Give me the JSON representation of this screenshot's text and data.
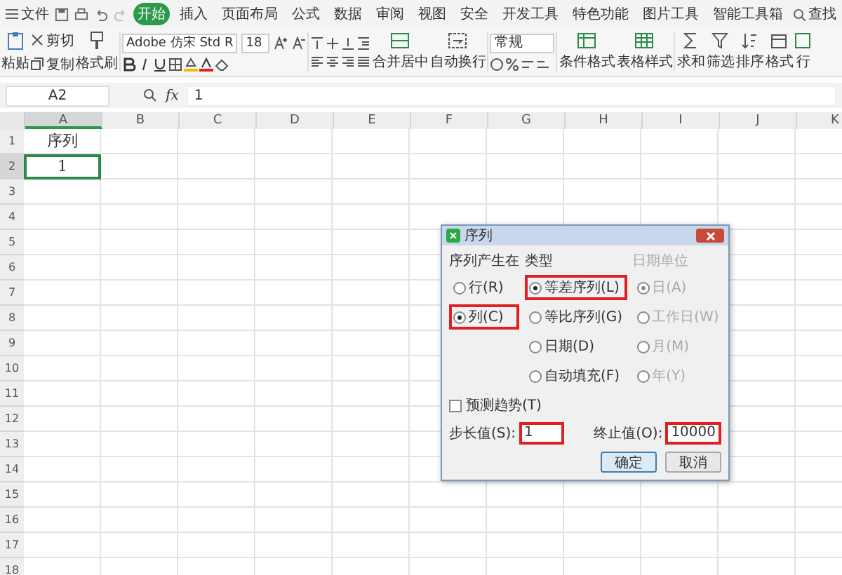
{
  "toolbar": {
    "menu_button": "文件",
    "tabs": [
      {
        "label": "开始",
        "selected": true
      },
      {
        "label": "插入",
        "selected": false
      },
      {
        "label": "页面布局",
        "selected": false
      },
      {
        "label": "公式",
        "selected": false
      },
      {
        "label": "数据",
        "selected": false
      },
      {
        "label": "审阅",
        "selected": false
      },
      {
        "label": "视图",
        "selected": false
      },
      {
        "label": "安全",
        "selected": false
      },
      {
        "label": "开发工具",
        "selected": false
      },
      {
        "label": "特色功能",
        "selected": false
      },
      {
        "label": "图片工具",
        "selected": false
      },
      {
        "label": "智能工具箱",
        "selected": false
      }
    ],
    "search": "查找"
  },
  "ribbon": {
    "paste": "粘贴",
    "cut": "剪切",
    "copy": "复制",
    "format_painter": "格式刷",
    "font_name": "Adobe 仿宋 Std R",
    "font_size": "18",
    "merge": "合并居中",
    "wrap": "自动换行",
    "number_format": "常规",
    "conditional_format": "条件格式",
    "table_style": "表格样式",
    "sum": "求和",
    "filter": "筛选",
    "sort": "排序",
    "format": "格式",
    "column_6": "行"
  },
  "formula_bar": {
    "cell_ref": "A2",
    "fx": "fx",
    "value": "1"
  },
  "sheet": {
    "columns": [
      "A",
      "B",
      "C",
      "D",
      "E",
      "F",
      "G",
      "H",
      "I",
      "J",
      "K"
    ],
    "rows": [
      {
        "number": "1",
        "cells": [
          {
            "text": "序列",
            "selected": false
          }
        ]
      },
      {
        "number": "2",
        "cells": [
          {
            "text": "1",
            "selected": true
          }
        ]
      },
      {
        "number": "3",
        "cells": []
      },
      {
        "number": "4",
        "cells": []
      },
      {
        "number": "5",
        "cells": []
      },
      {
        "number": "6",
        "cells": []
      },
      {
        "number": "7",
        "cells": []
      },
      {
        "number": "8",
        "cells": []
      },
      {
        "number": "9",
        "cells": []
      },
      {
        "number": "10",
        "cells": []
      },
      {
        "number": "11",
        "cells": []
      },
      {
        "number": "12",
        "cells": []
      },
      {
        "number": "13",
        "cells": []
      },
      {
        "number": "14",
        "cells": []
      },
      {
        "number": "15",
        "cells": []
      },
      {
        "number": "16",
        "cells": []
      },
      {
        "number": "17",
        "cells": []
      },
      {
        "number": "18",
        "cells": []
      }
    ]
  },
  "dialog": {
    "title": "序列",
    "sections": [
      {
        "heading": "序列产生在",
        "disabled": false,
        "options": [
          {
            "label": "行(R)",
            "selected": false,
            "highlighted": false
          },
          {
            "label": "列(C)",
            "selected": true,
            "highlighted": true
          }
        ]
      },
      {
        "heading": "类型",
        "disabled": false,
        "options": [
          {
            "label": "等差序列(L)",
            "selected": true,
            "highlighted": true
          },
          {
            "label": "等比序列(G)",
            "selected": false,
            "highlighted": false
          },
          {
            "label": "日期(D)",
            "selected": false,
            "highlighted": false
          },
          {
            "label": "自动填充(F)",
            "selected": false,
            "highlighted": false
          }
        ]
      },
      {
        "heading": "日期单位",
        "disabled": true,
        "options": [
          {
            "label": "日(A)",
            "selected": true,
            "highlighted": false
          },
          {
            "label": "工作日(W)",
            "selected": false,
            "highlighted": false
          },
          {
            "label": "月(M)",
            "selected": false,
            "highlighted": false
          },
          {
            "label": "年(Y)",
            "selected": false,
            "highlighted": false
          }
        ]
      }
    ],
    "trend": {
      "label": "预测趋势(T)",
      "checked": false
    },
    "step": {
      "label": "步长值(S):",
      "value": "1",
      "highlighted": true
    },
    "stop": {
      "label": "终止值(O):",
      "value": "10000",
      "highlighted": true
    },
    "buttons": [
      {
        "label": "确定",
        "default": true
      },
      {
        "label": "取消",
        "default": false
      }
    ]
  }
}
